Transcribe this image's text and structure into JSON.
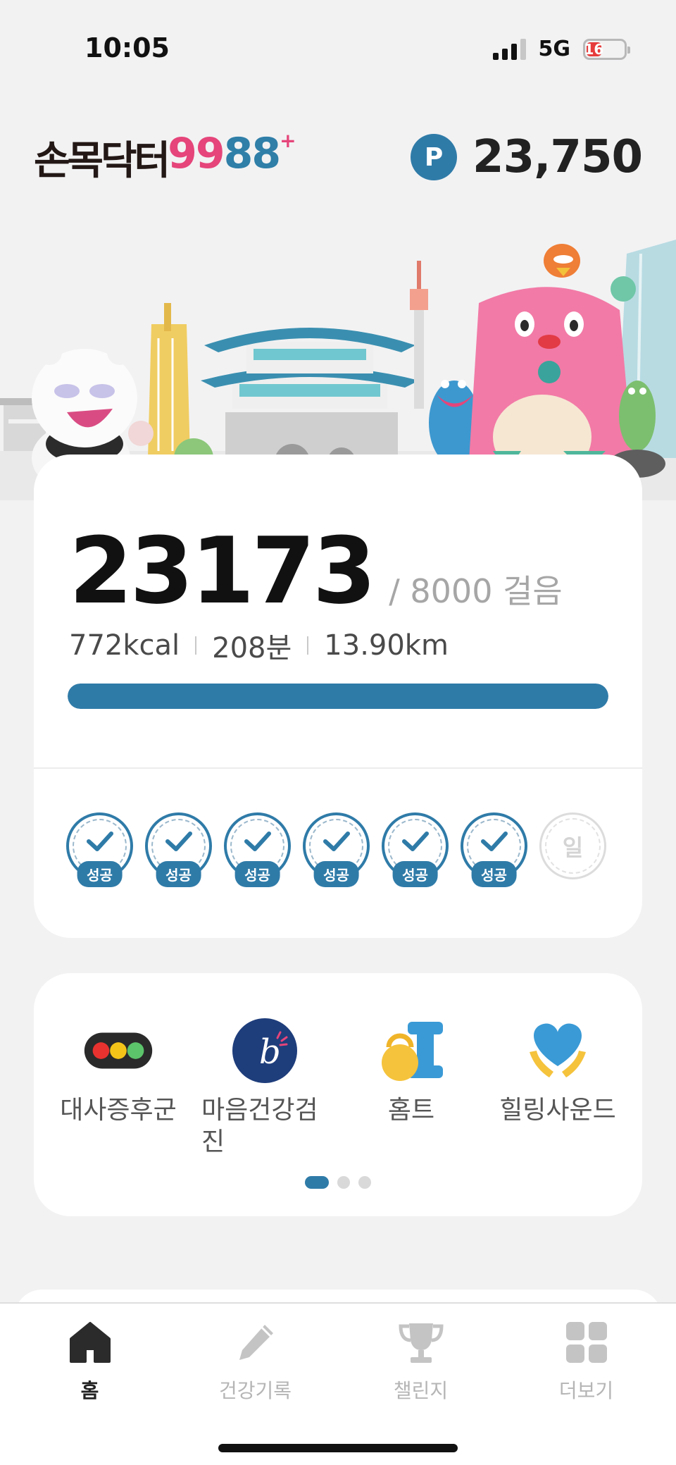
{
  "status_bar": {
    "time": "10:05",
    "network": "5G",
    "battery": "16",
    "battery_level_percent": 16
  },
  "header": {
    "logo_text": "손목닥터",
    "logo_9": "99",
    "logo_8": "88",
    "logo_plus": "+",
    "points_icon": "P",
    "points_value": "23,750"
  },
  "steps": {
    "count": "23173",
    "goal": "/ 8000 걸음",
    "kcal": "772kcal",
    "minutes": "208분",
    "distance": "13.90km",
    "progress_fraction": 1.0
  },
  "week": {
    "days": [
      {
        "label": "성공",
        "status": "success"
      },
      {
        "label": "성공",
        "status": "success"
      },
      {
        "label": "성공",
        "status": "success"
      },
      {
        "label": "성공",
        "status": "success"
      },
      {
        "label": "성공",
        "status": "success"
      },
      {
        "label": "성공",
        "status": "success"
      }
    ],
    "today": "일"
  },
  "menu": {
    "items": [
      {
        "label": "대사증후군",
        "icon": "traffic-light-icon"
      },
      {
        "label": "마음건강검진",
        "icon": "mind-check-icon"
      },
      {
        "label": "홈트",
        "icon": "kettlebell-dumbbell-icon"
      },
      {
        "label": "힐링사운드",
        "icon": "heart-hands-icon"
      }
    ],
    "pager": {
      "pages": 3,
      "active": 1
    }
  },
  "tabs": [
    {
      "label": "홈",
      "icon": "home-icon",
      "active": true
    },
    {
      "label": "건강기록",
      "icon": "pencil-icon",
      "active": false
    },
    {
      "label": "챌린지",
      "icon": "trophy-icon",
      "active": false
    },
    {
      "label": "더보기",
      "icon": "grid-icon",
      "active": false
    }
  ],
  "colors": {
    "brand_blue": "#2f7ba8",
    "brand_pink": "#e5457a",
    "background": "#f2f2f3"
  }
}
